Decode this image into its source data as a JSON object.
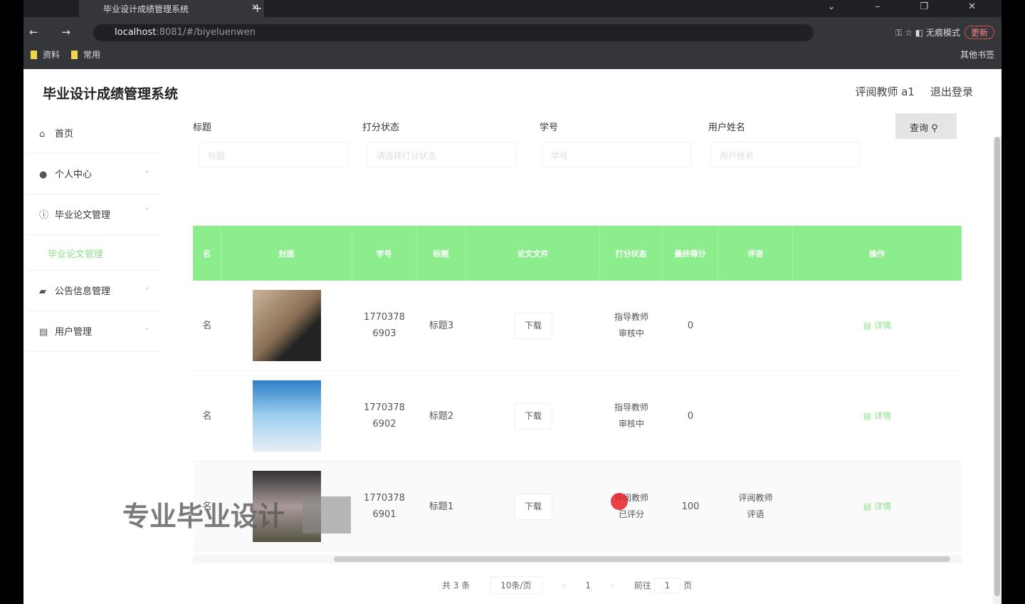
{
  "browser": {
    "tab_title": "毕业设计成绩管理系统",
    "url_host": "localhost",
    "url_rest": ":8081/#/biyeluenwen",
    "incognito": "无痕模式",
    "update": "更新",
    "bookmarks": [
      "资料",
      "常用"
    ],
    "other_bookmarks": "其他书签"
  },
  "header": {
    "title": "毕业设计成绩管理系统",
    "user": "评阅教师 a1",
    "logout": "退出登录"
  },
  "sidebar": {
    "items": [
      {
        "label": "首页"
      },
      {
        "label": "个人中心"
      },
      {
        "label": "毕业论文管理"
      },
      {
        "label": "公告信息管理"
      },
      {
        "label": "用户管理"
      }
    ],
    "sub": "毕业论文管理"
  },
  "filters": [
    {
      "label": "标题",
      "placeholder": "标题"
    },
    {
      "label": "打分状态",
      "placeholder": "请选择打分状态"
    },
    {
      "label": "学号",
      "placeholder": "学号"
    },
    {
      "label": "用户姓名",
      "placeholder": "用户姓名"
    }
  ],
  "query_button": "查询",
  "table": {
    "columns": [
      "名",
      "封面",
      "学号",
      "标题",
      "论文文件",
      "打分状态",
      "最终得分",
      "评语",
      "操作"
    ],
    "rows": [
      {
        "name": "名",
        "id": "17703786903",
        "title": "标题3",
        "file": "下载",
        "status": "指导教师审核中",
        "score": "0",
        "comment": "",
        "op": "详情"
      },
      {
        "name": "名",
        "id": "17703786902",
        "title": "标题2",
        "file": "下载",
        "status": "指导教师审核中",
        "score": "0",
        "comment": "",
        "op": "详情"
      },
      {
        "name": "名",
        "id": "17703786901",
        "title": "标题1",
        "file": "下载",
        "status": "评阅教师已评分",
        "score": "100",
        "comment": "评阅教师评语",
        "op": "详情"
      }
    ]
  },
  "pagination": {
    "total": "共 3 条",
    "page_size": "10条/页",
    "current": "1",
    "goto": "前往",
    "goto_value": "1",
    "page_unit": "页"
  },
  "watermark": "专业毕业设计"
}
